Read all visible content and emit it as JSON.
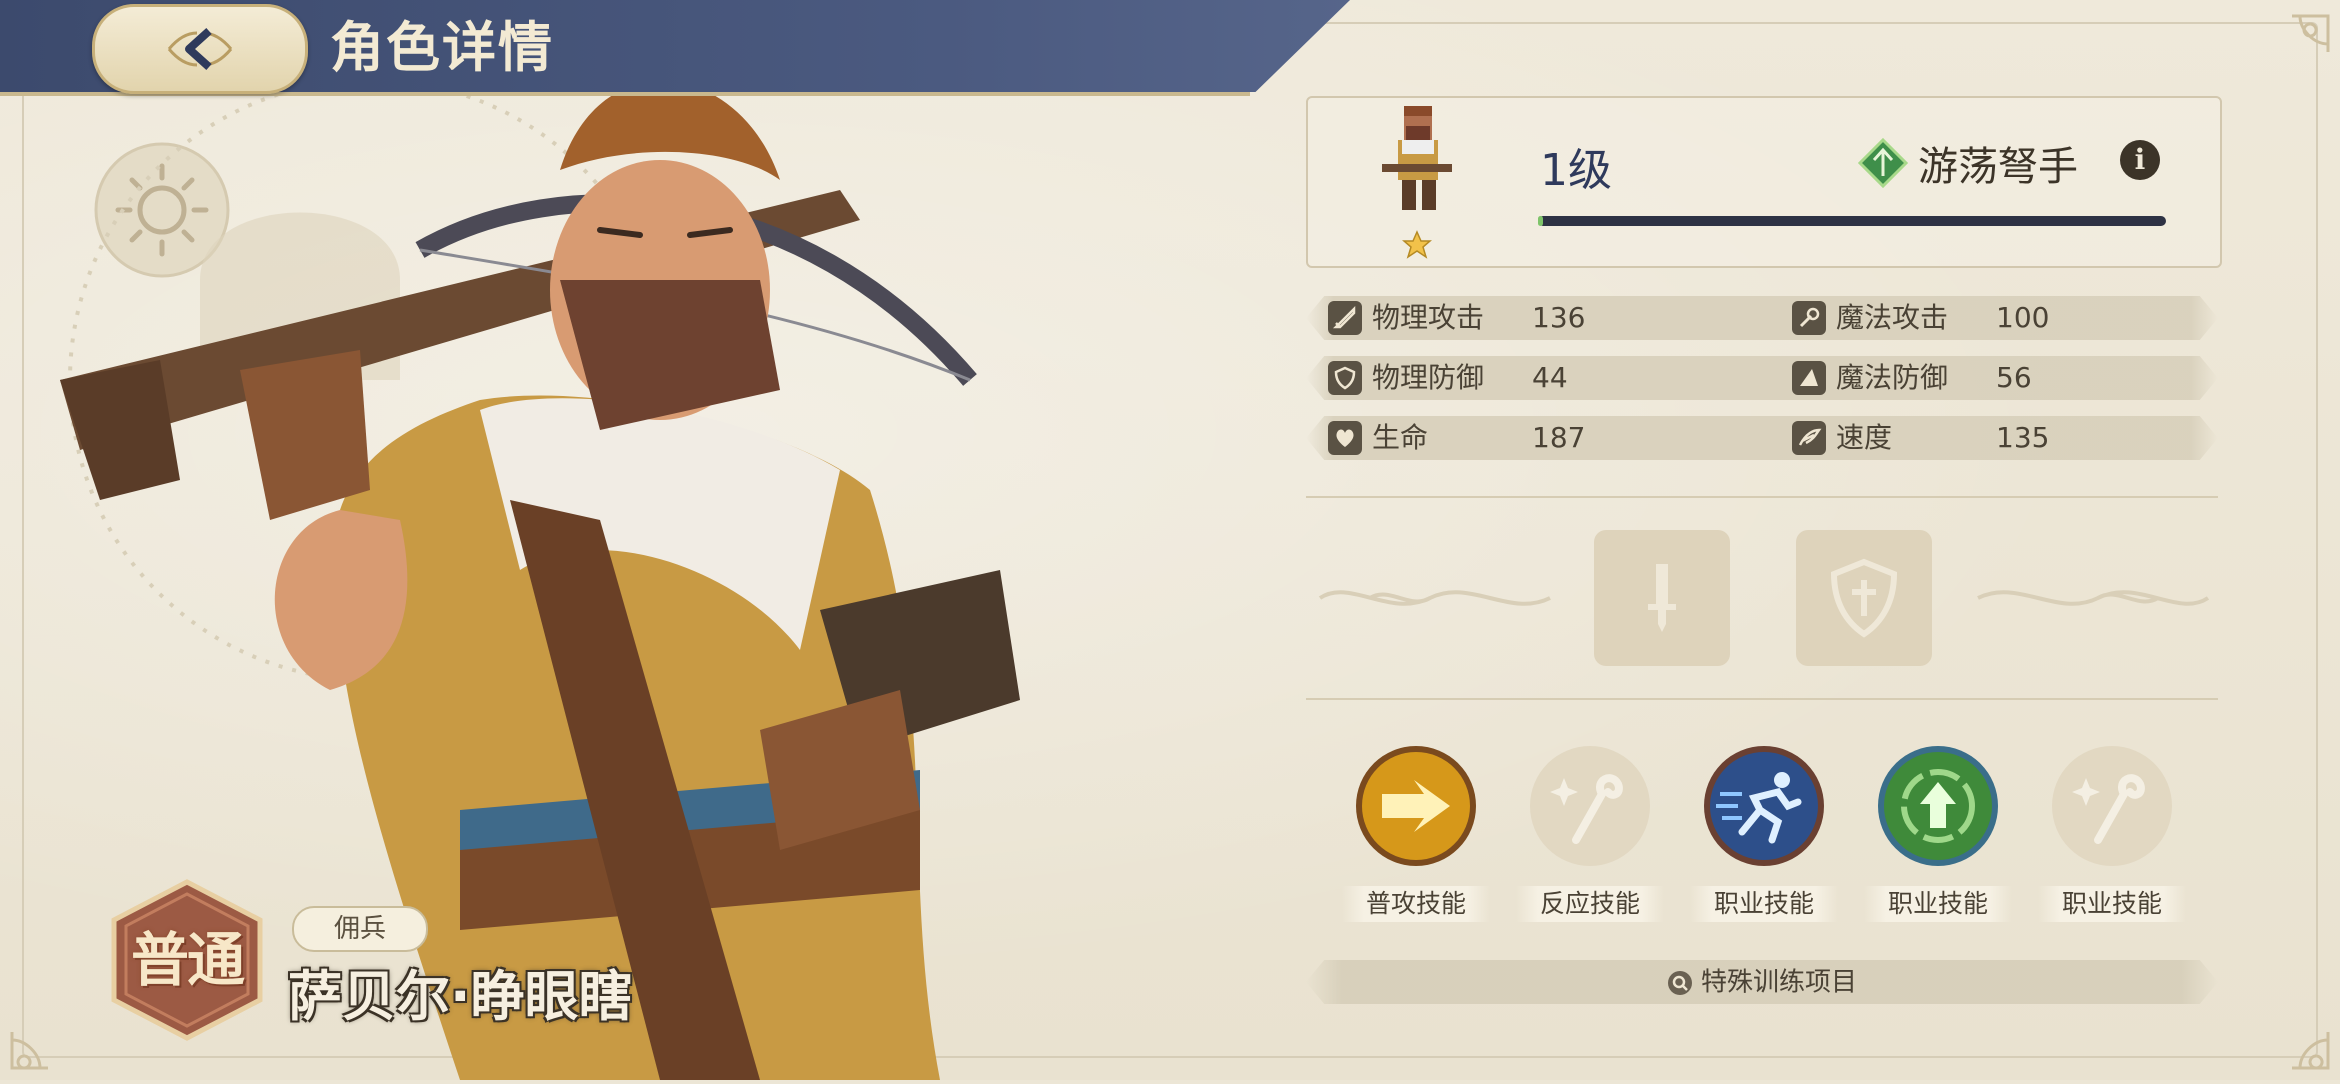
{
  "header": {
    "title": "角色详情",
    "back_icon": "back-arrow-icon"
  },
  "character": {
    "rarity": "普通",
    "role_tag": "佣兵",
    "name": "萨贝尔·睁眼瞎"
  },
  "level_card": {
    "level": "1级",
    "class_name": "游荡弩手",
    "info_icon": "info-icon",
    "star_count": 1,
    "xp_fraction": 0.0
  },
  "stats": [
    {
      "icon": "sword-icon",
      "label": "物理攻击",
      "value": "136"
    },
    {
      "icon": "wand-icon",
      "label": "魔法攻击",
      "value": "100"
    },
    {
      "icon": "shield-icon",
      "label": "物理防御",
      "value": "44"
    },
    {
      "icon": "wizard-hat-icon",
      "label": "魔法防御",
      "value": "56"
    },
    {
      "icon": "heart-icon",
      "label": "生命",
      "value": "187"
    },
    {
      "icon": "wing-icon",
      "label": "速度",
      "value": "135"
    }
  ],
  "equipment": [
    {
      "icon": "sword-slot-icon"
    },
    {
      "icon": "shield-slot-icon"
    }
  ],
  "skills": [
    {
      "label": "普攻技能",
      "icon": "double-arrow-icon",
      "state": "active"
    },
    {
      "label": "反应技能",
      "icon": "magic-staff-icon",
      "state": "empty"
    },
    {
      "label": "职业技能",
      "icon": "sprint-icon",
      "state": "active"
    },
    {
      "label": "职业技能",
      "icon": "up-arrow-icon",
      "state": "active"
    },
    {
      "label": "职业技能",
      "icon": "magic-staff-icon",
      "state": "empty"
    }
  ],
  "training_button": {
    "label": "特殊训练项目",
    "icon": "search-icon"
  },
  "colors": {
    "header": "#3c4a6d",
    "background": "#ece6d6",
    "xp_bar": "#2e3244",
    "class_gem": "#3f8f4a"
  }
}
